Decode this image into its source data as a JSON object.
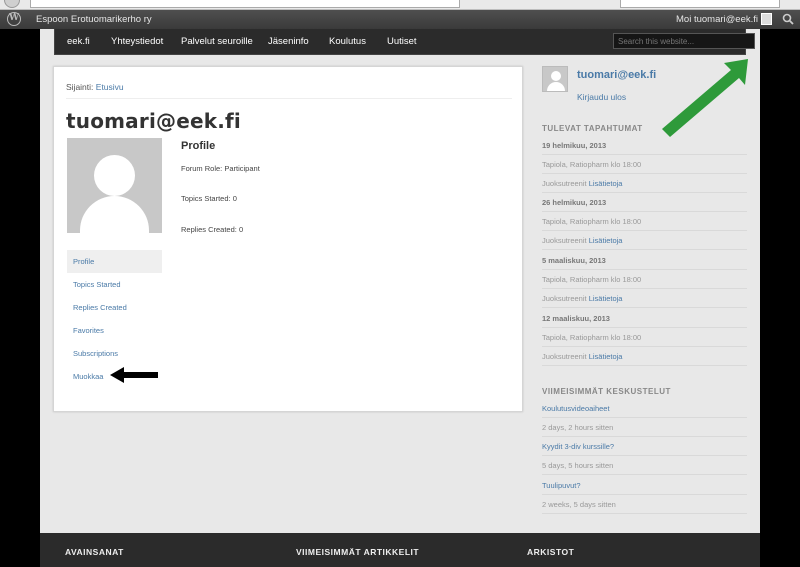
{
  "adminbar": {
    "site_name": "Espoon Erotuomarikerho ry",
    "howdy": "Moi tuomari@eek.fi"
  },
  "nav": {
    "items": [
      "eek.fi",
      "Yhteystiedot",
      "Palvelut seuroille",
      "Jäseninfo",
      "Koulutus",
      "Uutiset"
    ],
    "search_placeholder": "Search this website..."
  },
  "breadcrumb": {
    "label": "Sijainti:",
    "link": "Etusivu"
  },
  "profile": {
    "username": "tuomari@eek.fi",
    "heading": "Profile",
    "forum_role": "Forum Role: Participant",
    "topics_started": "Topics Started: 0",
    "replies_created": "Replies Created: 0"
  },
  "profile_menu": [
    "Profile",
    "Topics Started",
    "Replies Created",
    "Favorites",
    "Subscriptions",
    "Muokkaa"
  ],
  "sidebar": {
    "user": "tuomari@eek.fi",
    "logout": "Kirjaudu ulos",
    "events_heading": "TULEVAT TAPAHTUMAT",
    "events": [
      {
        "date": "19 helmikuu, 2013",
        "place": "Tapiola, Ratiopharm klo 18:00",
        "desc": "Juoksutreenit",
        "more": "Lisätietoja"
      },
      {
        "date": "26 helmikuu, 2013",
        "place": "Tapiola, Ratiopharm klo 18:00",
        "desc": "Juoksutreenit",
        "more": "Lisätietoja"
      },
      {
        "date": "5 maaliskuu, 2013",
        "place": "Tapiola, Ratiopharm klo 18:00",
        "desc": "Juoksutreenit",
        "more": "Lisätietoja"
      },
      {
        "date": "12 maaliskuu, 2013",
        "place": "Tapiola, Ratiopharm klo 18:00",
        "desc": "Juoksutreenit",
        "more": "Lisätietoja"
      }
    ],
    "discussions_heading": "VIIMEISIMMÄT KESKUSTELUT",
    "discussions": [
      {
        "title": "Koulutusvideoaiheet",
        "time": "2 days, 2 hours sitten"
      },
      {
        "title": "Kyydit 3-div kurssille?",
        "time": "5 days, 5 hours sitten"
      },
      {
        "title": "Tuulipuvut?",
        "time": "2 weeks, 5 days sitten"
      }
    ]
  },
  "footer": {
    "col1": "AVAINSANAT",
    "col2": "VIIMEISIMMÄT ARTIKKELIT",
    "col3": "ARKISTOT"
  },
  "colors": {
    "link": "#4a7aa7",
    "green_arrow": "#2e9a3a",
    "adminbar": "#464646"
  }
}
